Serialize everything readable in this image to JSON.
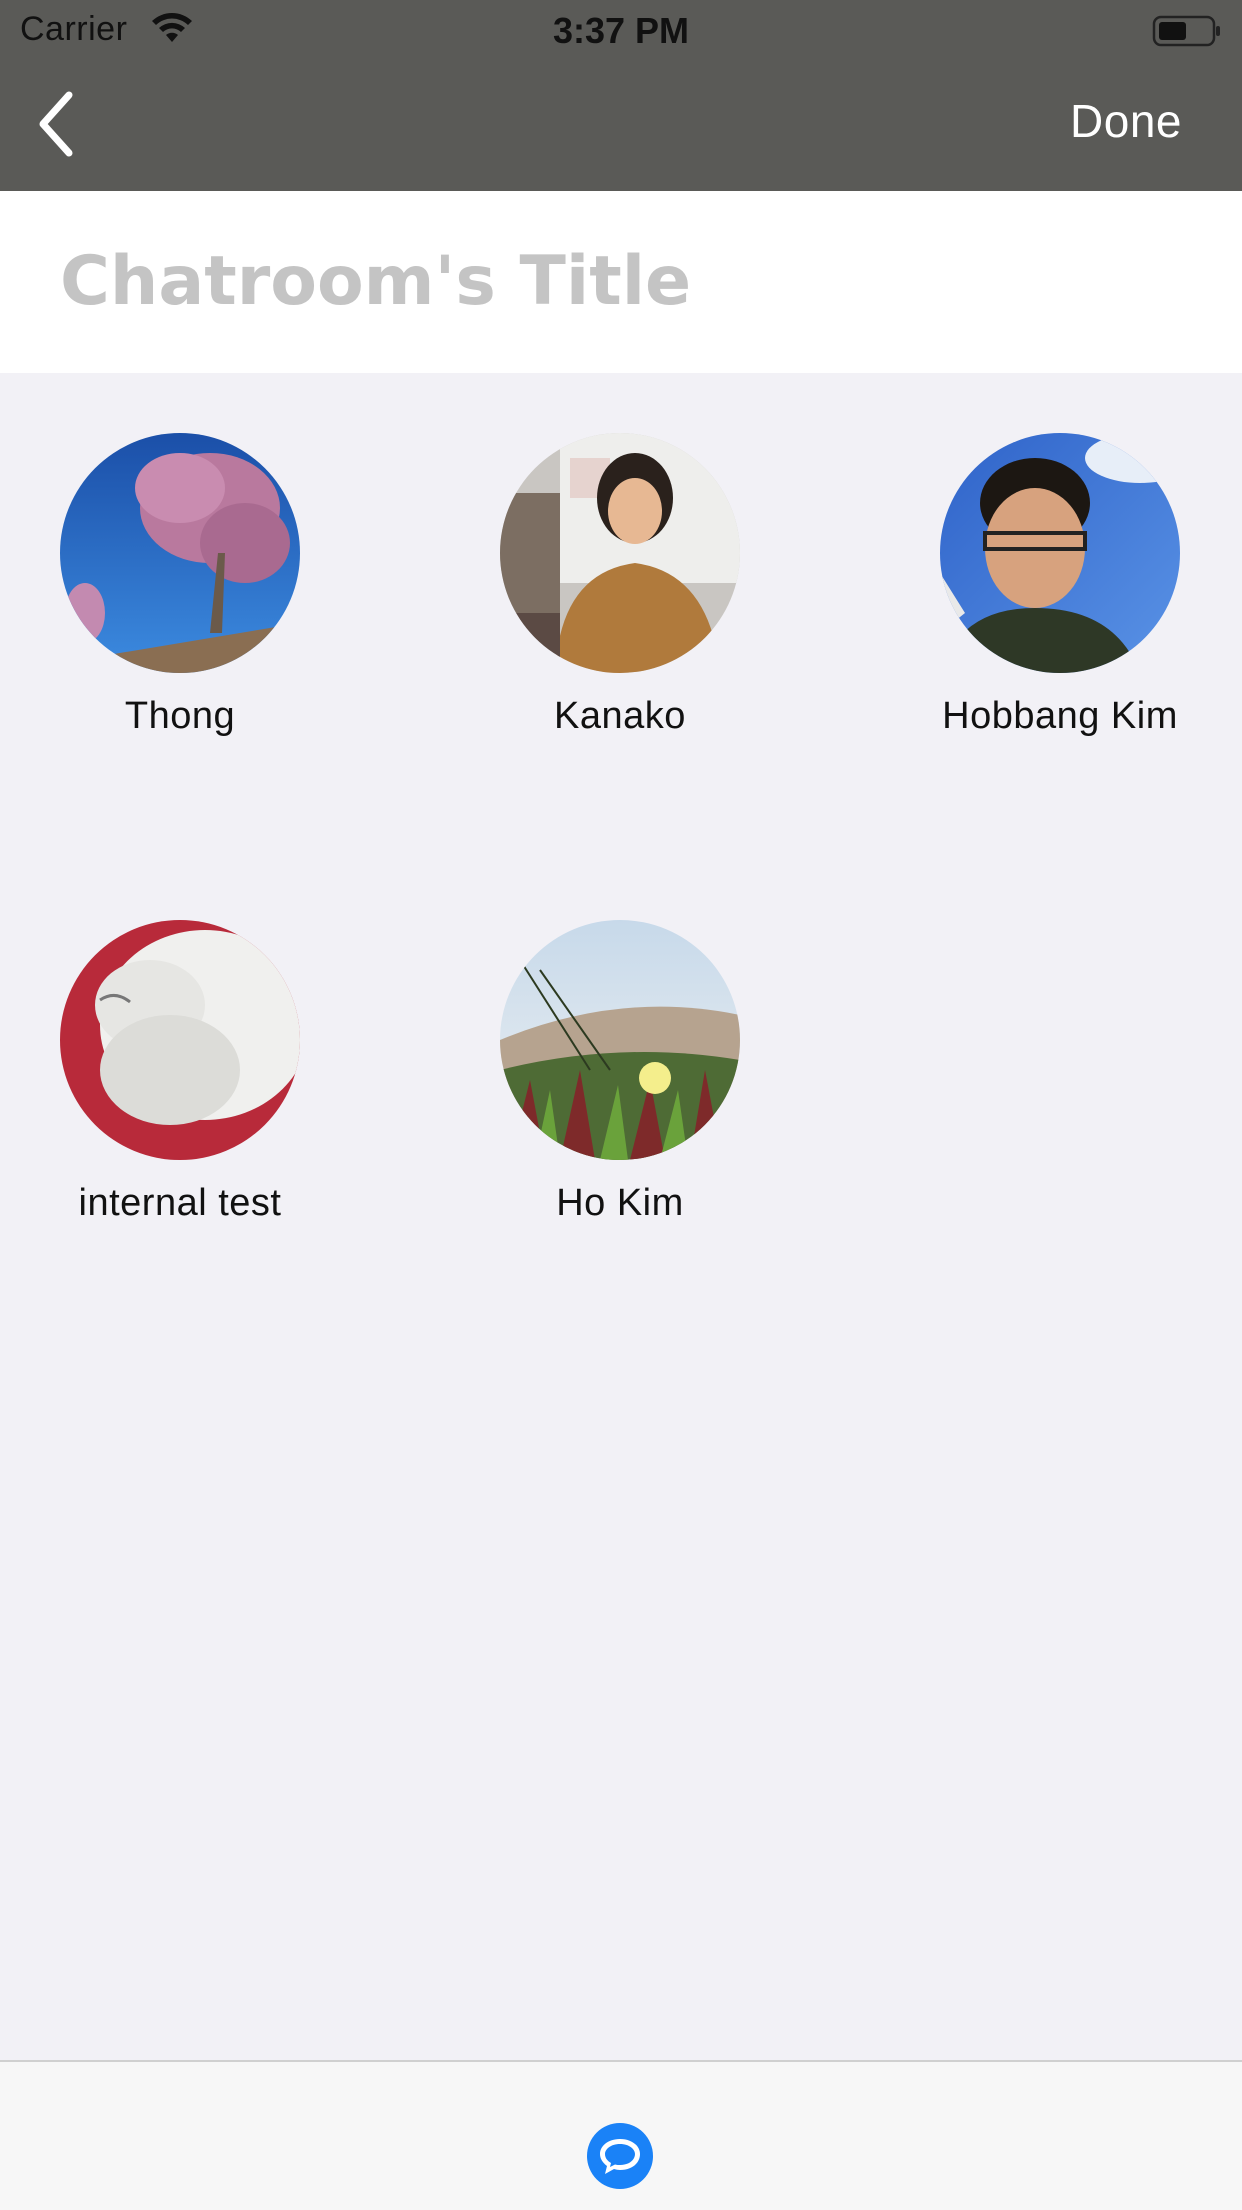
{
  "status_bar": {
    "carrier": "Carrier",
    "time": "3:37 PM",
    "wifi_icon": "wifi-icon",
    "battery_icon": "battery-icon"
  },
  "nav": {
    "back_icon": "chevron-left-icon",
    "done_label": "Done"
  },
  "title_field": {
    "placeholder": "Chatroom's Title",
    "value": ""
  },
  "members": [
    {
      "name": "Thong"
    },
    {
      "name": "Kanako"
    },
    {
      "name": "Hobbang Kim"
    },
    {
      "name": "internal test"
    },
    {
      "name": "Ho Kim"
    }
  ],
  "tab_bar": {
    "chat_icon": "chat-bubble-icon"
  },
  "colors": {
    "header_bg": "#5a5a57",
    "background": "#f2f1f6",
    "accent": "#1a82f7"
  }
}
